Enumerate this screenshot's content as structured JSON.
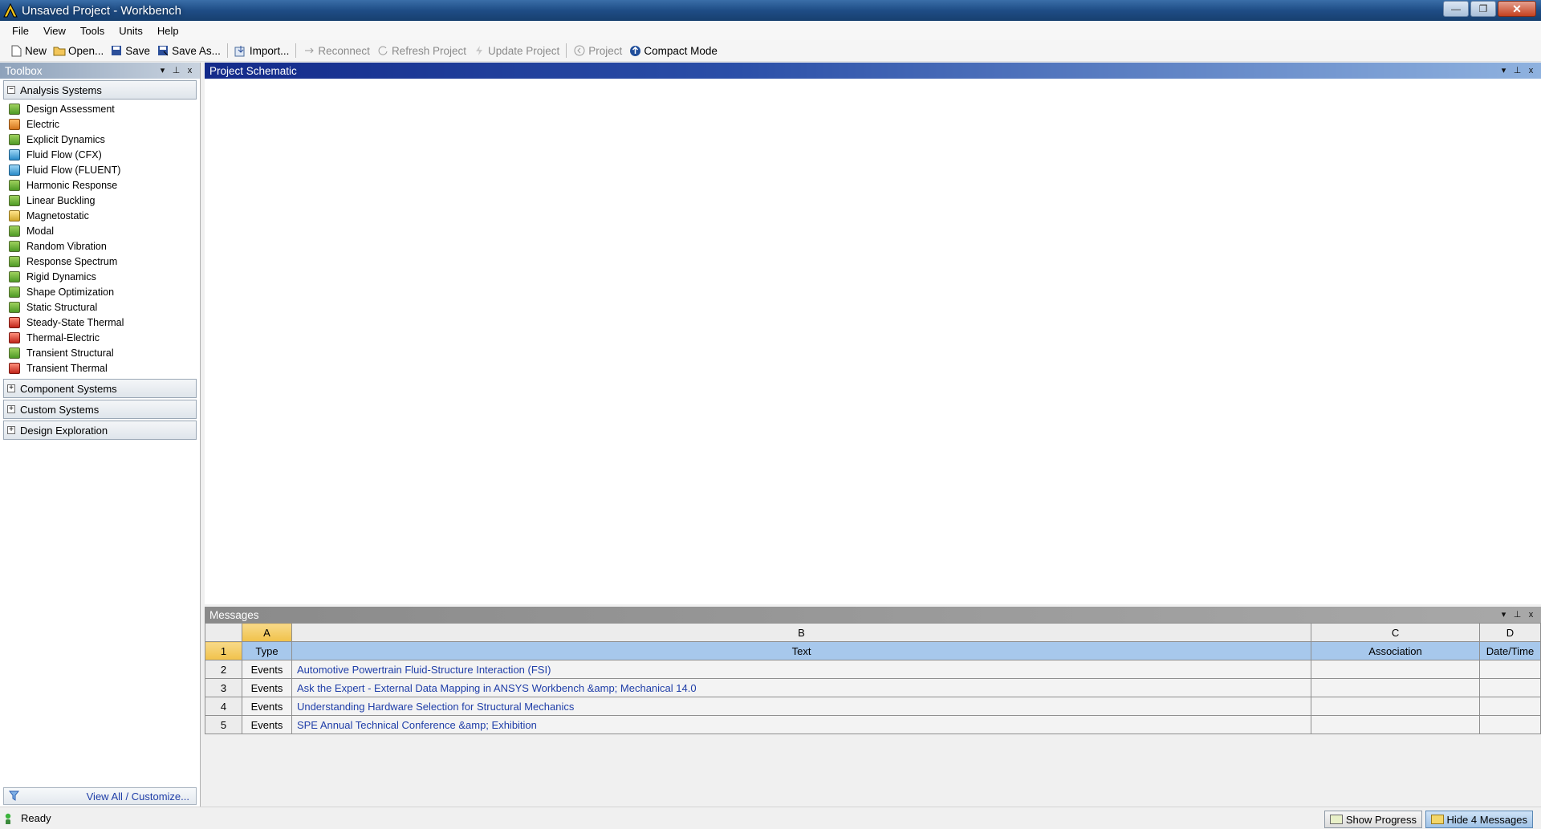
{
  "window": {
    "title": "Unsaved Project - Workbench",
    "minimize": "—",
    "maximize": "❐",
    "close": "✕"
  },
  "menu": [
    "File",
    "View",
    "Tools",
    "Units",
    "Help"
  ],
  "toolbar": {
    "new": "New",
    "open": "Open...",
    "save": "Save",
    "save_as": "Save As...",
    "import": "Import...",
    "reconnect": "Reconnect",
    "refresh": "Refresh Project",
    "update": "Update Project",
    "project": "Project",
    "compact": "Compact Mode"
  },
  "toolbox": {
    "title": "Toolbox",
    "categories": {
      "analysis": "Analysis Systems",
      "component": "Component Systems",
      "custom": "Custom Systems",
      "exploration": "Design Exploration"
    },
    "analysis_items": [
      {
        "label": "Design Assessment",
        "icon": "design-assessment-icon",
        "color": "green"
      },
      {
        "label": "Electric",
        "icon": "electric-icon",
        "color": "orange"
      },
      {
        "label": "Explicit Dynamics",
        "icon": "explicit-dynamics-icon",
        "color": "green"
      },
      {
        "label": "Fluid Flow (CFX)",
        "icon": "fluid-flow-cfx-icon",
        "color": "blue"
      },
      {
        "label": "Fluid Flow (FLUENT)",
        "icon": "fluid-flow-fluent-icon",
        "color": "blue"
      },
      {
        "label": "Harmonic Response",
        "icon": "harmonic-response-icon",
        "color": "green"
      },
      {
        "label": "Linear Buckling",
        "icon": "linear-buckling-icon",
        "color": "green"
      },
      {
        "label": "Magnetostatic",
        "icon": "magnetostatic-icon",
        "color": "yellow"
      },
      {
        "label": "Modal",
        "icon": "modal-icon",
        "color": "green"
      },
      {
        "label": "Random Vibration",
        "icon": "random-vibration-icon",
        "color": "green"
      },
      {
        "label": "Response Spectrum",
        "icon": "response-spectrum-icon",
        "color": "green"
      },
      {
        "label": "Rigid Dynamics",
        "icon": "rigid-dynamics-icon",
        "color": "green"
      },
      {
        "label": "Shape Optimization",
        "icon": "shape-optimization-icon",
        "color": "green"
      },
      {
        "label": "Static Structural",
        "icon": "static-structural-icon",
        "color": "green"
      },
      {
        "label": "Steady-State Thermal",
        "icon": "steady-state-thermal-icon",
        "color": "red"
      },
      {
        "label": "Thermal-Electric",
        "icon": "thermal-electric-icon",
        "color": "red"
      },
      {
        "label": "Transient Structural",
        "icon": "transient-structural-icon",
        "color": "green"
      },
      {
        "label": "Transient Thermal",
        "icon": "transient-thermal-icon",
        "color": "red"
      }
    ],
    "footer_link": "View All / Customize..."
  },
  "schematic": {
    "title": "Project Schematic"
  },
  "messages": {
    "title": "Messages",
    "columns": [
      "A",
      "B",
      "C",
      "D"
    ],
    "header_row": {
      "num": "1",
      "type": "Type",
      "text": "Text",
      "association": "Association",
      "datetime": "Date/Time"
    },
    "rows": [
      {
        "num": "2",
        "type": "Events",
        "text": "Automotive Powertrain Fluid-Structure Interaction (FSI)"
      },
      {
        "num": "3",
        "type": "Events",
        "text": "Ask the Expert - External Data Mapping in ANSYS Workbench &amp; Mechanical 14.0"
      },
      {
        "num": "4",
        "type": "Events",
        "text": "Understanding Hardware Selection for Structural Mechanics"
      },
      {
        "num": "5",
        "type": "Events",
        "text": "SPE Annual Technical Conference &amp; Exhibition"
      }
    ]
  },
  "status": {
    "text": "Ready",
    "show_progress": "Show Progress",
    "hide_messages": "Hide 4 Messages"
  },
  "panel_controls": {
    "dropdown": "▾",
    "pin": "⊥",
    "close": "x"
  }
}
